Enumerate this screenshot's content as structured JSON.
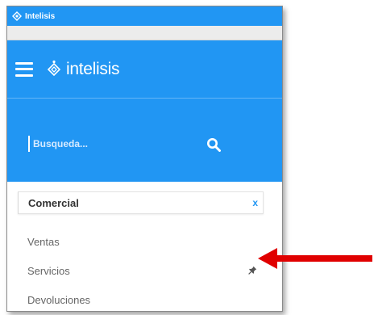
{
  "window": {
    "title": "Intelisis"
  },
  "header": {
    "logo_text": "intelisis",
    "menu_icon": "hamburger-menu-icon"
  },
  "search": {
    "placeholder": "Busqueda...",
    "icon": "search-icon"
  },
  "section": {
    "title": "Comercial",
    "close_label": "x",
    "items": [
      {
        "label": "Ventas",
        "pinned": false
      },
      {
        "label": "Servicios",
        "pinned": true
      },
      {
        "label": "Devoluciones",
        "pinned": false
      }
    ]
  },
  "colors": {
    "brand_blue": "#2196f3",
    "arrow_red": "#e00000",
    "item_text": "#666666"
  }
}
